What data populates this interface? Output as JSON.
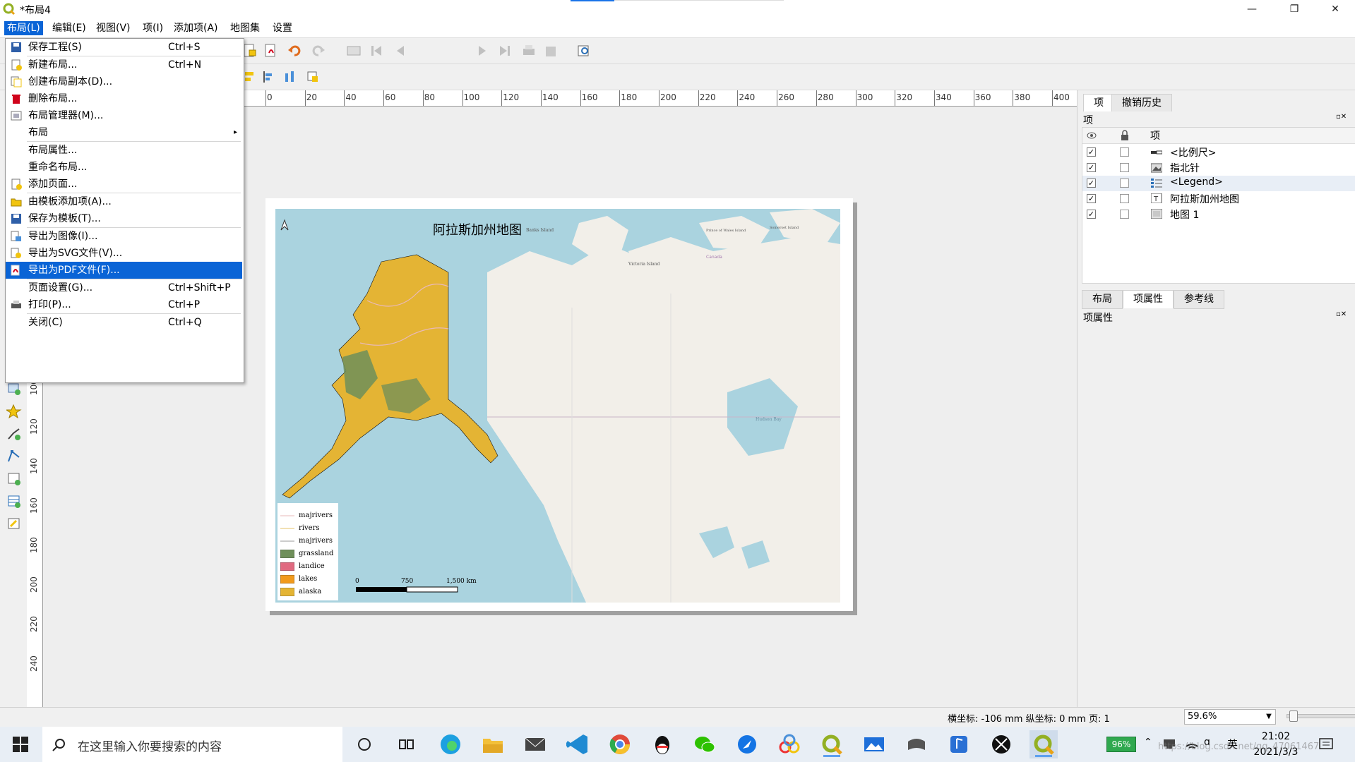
{
  "window": {
    "title": "*布局4",
    "minimize": "—",
    "restore": "❐",
    "close": "✕"
  },
  "menubar": [
    {
      "label": "布局(L)"
    },
    {
      "label": "编辑(E)"
    },
    {
      "label": "视图(V)"
    },
    {
      "label": "项(I)"
    },
    {
      "label": "添加项(A)"
    },
    {
      "label": "地图集"
    },
    {
      "label": "设置"
    }
  ],
  "toolbar": {
    "page_number": "1"
  },
  "hruler": [
    "0",
    "20",
    "40",
    "60",
    "80",
    "100",
    "120",
    "140",
    "160",
    "180",
    "200",
    "220",
    "240",
    "260",
    "280",
    "300",
    "320",
    "340",
    "360",
    "380",
    "400"
  ],
  "vruler": [
    "100",
    "120",
    "140",
    "160",
    "180",
    "200",
    "220",
    "240"
  ],
  "dropdown": [
    {
      "label": "保存工程(S)",
      "shortcut": "Ctrl+S"
    },
    {
      "label": "新建布局...",
      "shortcut": "Ctrl+N"
    },
    {
      "label": "创建布局副本(D)...",
      "shortcut": ""
    },
    {
      "label": "删除布局...",
      "shortcut": ""
    },
    {
      "label": "布局管理器(M)...",
      "shortcut": ""
    },
    {
      "label": "布局",
      "shortcut": ""
    },
    {
      "label": "布局属性...",
      "shortcut": ""
    },
    {
      "label": "重命名布局...",
      "shortcut": ""
    },
    {
      "label": "添加页面...",
      "shortcut": ""
    },
    {
      "label": "由模板添加项(A)...",
      "shortcut": ""
    },
    {
      "label": "保存为模板(T)...",
      "shortcut": ""
    },
    {
      "label": "导出为图像(I)...",
      "shortcut": ""
    },
    {
      "label": "导出为SVG文件(V)...",
      "shortcut": ""
    },
    {
      "label": "导出为PDF文件(F)...",
      "shortcut": ""
    },
    {
      "label": "页面设置(G)...",
      "shortcut": "Ctrl+Shift+P"
    },
    {
      "label": "打印(P)...",
      "shortcut": "Ctrl+P"
    },
    {
      "label": "关闭(C)",
      "shortcut": "Ctrl+Q"
    }
  ],
  "map": {
    "title": "阿拉斯加州地图",
    "places": {
      "banks": "Banks Island",
      "victoria": "Victoria Island",
      "pow": "Prince of Wales Island",
      "somerset": "Somerset Island",
      "canada": "Canada",
      "hudson": "Hudson Bay"
    },
    "legend": [
      {
        "label": "majrivers",
        "color": "#e9b9b9",
        "kind": "line"
      },
      {
        "label": "rivers",
        "color": "#e6c36a",
        "kind": "line"
      },
      {
        "label": "majrivers",
        "color": "#999999",
        "kind": "line"
      },
      {
        "label": "grassland",
        "color": "#6f8f5a",
        "kind": "fill"
      },
      {
        "label": "landice",
        "color": "#e06a80",
        "kind": "fill"
      },
      {
        "label": "lakes",
        "color": "#f19a1c",
        "kind": "fill"
      },
      {
        "label": "alaska",
        "color": "#e4b434",
        "kind": "fill"
      }
    ],
    "scale": {
      "t0": "0",
      "t1": "750",
      "t2": "1,500 km"
    }
  },
  "rightpanel": {
    "tabs": [
      "项",
      "撤销历史"
    ],
    "section_label": "项",
    "col_label": "项",
    "items": [
      {
        "label": "<比例尺>",
        "visible": "✓"
      },
      {
        "label": "指北针",
        "visible": "✓"
      },
      {
        "label": "<Legend>",
        "visible": "✓"
      },
      {
        "label": "阿拉斯加州地图",
        "visible": "✓"
      },
      {
        "label": "地图 1",
        "visible": "✓"
      }
    ],
    "bottom_tabs": [
      "布局",
      "项属性",
      "参考线"
    ],
    "props_label": "项属性"
  },
  "status": {
    "coords": "横坐标: -106 mm 纵坐标: 0 mm  页: 1",
    "zoom": "59.6%"
  },
  "taskbar": {
    "search_placeholder": "在这里输入你要搜索的内容",
    "battery": "96%",
    "ime": "英",
    "time": "21:02",
    "date": "2021/3/3",
    "watermark": "https://blog.csdn.net/qq_47061467"
  },
  "colors": {
    "accent": "#0a64d6",
    "water": "#aad3df",
    "land": "#f2efe9",
    "alaska": "#e4b434"
  }
}
